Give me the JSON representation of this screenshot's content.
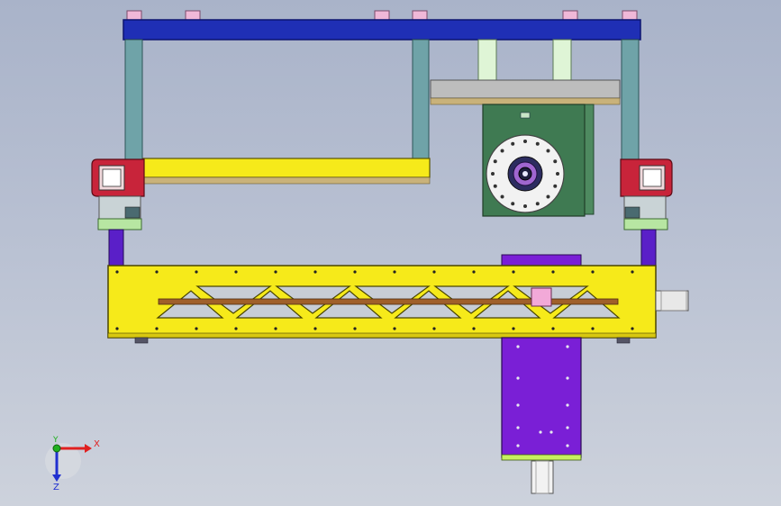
{
  "viewport": {
    "background_top": "#a9b3c9",
    "background_bottom": "#cdd2dc"
  },
  "colors": {
    "top_beam": "#1f2fb5",
    "columns": "#6fa3a8",
    "yellow_frame": "#f6ea1a",
    "red_block": "#c8243a",
    "gearbox": "#3f7a52",
    "purple_carriage": "#7a1fd6",
    "light_green": "#b7e6a2",
    "copper_rod": "#a0602a",
    "guide_plate": "#b4b4b4",
    "pink_block": "#f2a9d8"
  },
  "triad": {
    "x_label": "X",
    "y_label": "Y",
    "z_label": "Z",
    "x_color": "#e02020",
    "y_color": "#20b020",
    "z_color": "#2030d0"
  }
}
